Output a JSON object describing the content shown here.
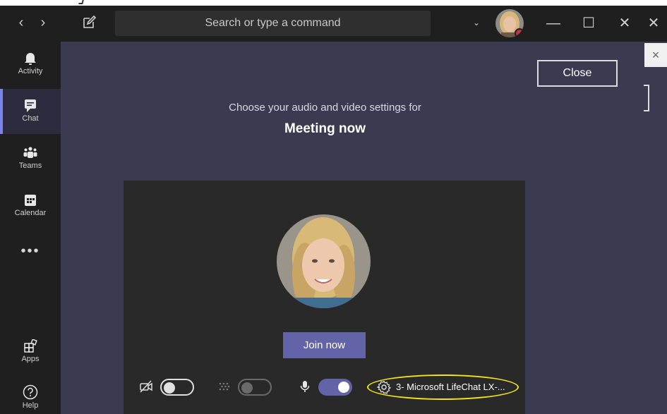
{
  "titlebar": {
    "search_placeholder": "Search or type a command",
    "back_glyph": "‹",
    "forward_glyph": "›",
    "minimize_glyph": "—",
    "maximize_glyph": "☐",
    "close_glyph": "✕",
    "dropdown_glyph": "⌄"
  },
  "rail": {
    "items": [
      {
        "label": "Activity",
        "icon": "bell-icon"
      },
      {
        "label": "Chat",
        "icon": "chat-icon",
        "active": true
      },
      {
        "label": "Teams",
        "icon": "teams-icon"
      },
      {
        "label": "Calendar",
        "icon": "calendar-icon"
      },
      {
        "label": "Apps",
        "icon": "apps-icon"
      },
      {
        "label": "Help",
        "icon": "help-icon"
      }
    ],
    "more_glyph": "•••"
  },
  "main": {
    "close_label": "Close",
    "side_close_glyph": "×",
    "subtitle": "Choose your audio and video settings for",
    "title": "Meeting now"
  },
  "preview": {
    "join_label": "Join now",
    "camera_toggle": "off",
    "blur_toggle": "off",
    "mic_toggle": "on",
    "device_label": "3- Microsoft LifeChat LX-..."
  },
  "colors": {
    "rail_bg": "#1f1f1f",
    "main_bg": "#3b3a50",
    "panel_bg": "#292929",
    "accent": "#6264a7",
    "highlight_ellipse": "#f2e41a",
    "status_dnd": "#c4314b"
  }
}
